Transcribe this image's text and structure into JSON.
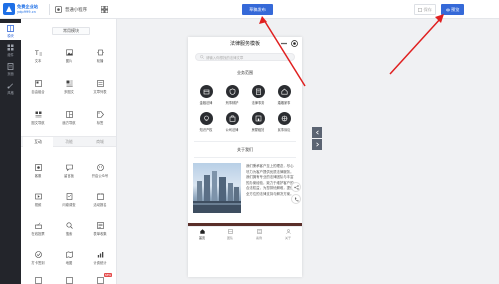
{
  "header": {
    "logo_line1": "免费企业站",
    "logo_line2": "ydp999.cn",
    "app_type_label": "普通小程序",
    "publish_label": "草稿发布",
    "save_label": "保存",
    "preview_label": "预览"
  },
  "leftnav": {
    "items": [
      {
        "label": "模块",
        "icon": "module-icon"
      },
      {
        "label": "组件",
        "icon": "component-icon"
      },
      {
        "label": "页面",
        "icon": "page-icon"
      },
      {
        "label": "风格",
        "icon": "style-icon"
      }
    ]
  },
  "panel": {
    "common_title": "常用模块",
    "common_items": [
      {
        "label": "文本",
        "icon": "text-icon"
      },
      {
        "label": "图片",
        "icon": "image-icon"
      },
      {
        "label": "轮播",
        "icon": "carousel-icon"
      },
      {
        "label": "自由组合",
        "icon": "free-combo-icon"
      },
      {
        "label": "多图文",
        "icon": "multi-article-icon"
      },
      {
        "label": "文章列表",
        "icon": "article-list-icon"
      },
      {
        "label": "图文导航",
        "icon": "nav-icon"
      },
      {
        "label": "魔方导航",
        "icon": "cube-nav-icon"
      },
      {
        "label": "标签",
        "icon": "tag-icon"
      }
    ],
    "tabs": [
      "互动",
      "功能",
      "商城"
    ],
    "interactive_items": [
      {
        "label": "客服",
        "icon": "service-icon"
      },
      {
        "label": "留言板",
        "icon": "message-icon"
      },
      {
        "label": "开启公众号",
        "icon": "official-account-icon"
      },
      {
        "label": "视频",
        "icon": "video-icon"
      },
      {
        "label": "问卷调查",
        "icon": "survey-icon"
      },
      {
        "label": "活动报名",
        "icon": "signup-icon"
      },
      {
        "label": "在线投票",
        "icon": "vote-icon"
      },
      {
        "label": "搜索",
        "icon": "search-icon"
      },
      {
        "label": "表单收集",
        "icon": "form-icon"
      },
      {
        "label": "打卡签到",
        "icon": "checkin-icon"
      },
      {
        "label": "地图",
        "icon": "map-icon"
      },
      {
        "label": "计费统计",
        "icon": "stats-icon"
      }
    ],
    "badge_new": "NEW"
  },
  "phone": {
    "title": "法律服务模板",
    "search_placeholder": "请输入你想找的法律文章",
    "section_business": "业务范围",
    "business_items": [
      {
        "label": "金融法律",
        "icon": "finance-icon"
      },
      {
        "label": "刑事辩护",
        "icon": "defense-icon"
      },
      {
        "label": "法律事务",
        "icon": "legal-affairs-icon"
      },
      {
        "label": "婚姻家事",
        "icon": "family-icon"
      },
      {
        "label": "知识产权",
        "icon": "ip-icon"
      },
      {
        "label": "公司法律",
        "icon": "company-law-icon"
      },
      {
        "label": "房屋租赁",
        "icon": "lease-icon"
      },
      {
        "label": "民事诉讼",
        "icon": "civil-icon"
      }
    ],
    "section_about": "关于我们",
    "about_text": "我们秉承客户至上的理念，尽心尽力为客户提供优质法律服务。我们拥有专业的法律团队与丰富的办案经验，致力于维护客户的合法权益，为您排忧解难，提供全方位的法律支持与解决方案。",
    "tabbar": [
      {
        "label": "首页",
        "icon": "home-icon"
      },
      {
        "label": "团队",
        "icon": "team-icon"
      },
      {
        "label": "案例",
        "icon": "case-icon"
      },
      {
        "label": "关于",
        "icon": "about-icon"
      }
    ]
  },
  "colors": {
    "primary": "#3569d8",
    "nav_bg": "#23252b",
    "arrow": "#e02020"
  }
}
